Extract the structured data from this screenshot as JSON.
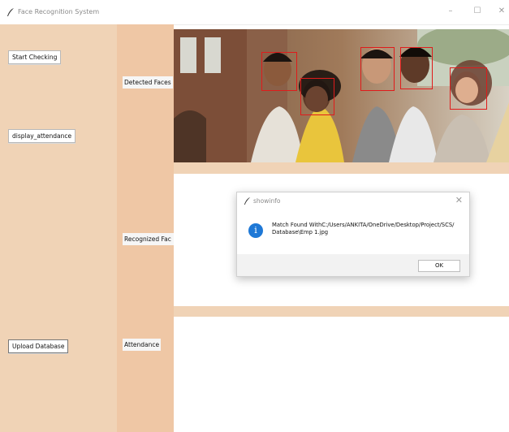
{
  "window": {
    "title": "Face Recognition System",
    "minimize": "–",
    "maximize": "☐",
    "close": "✕"
  },
  "sidebar": {
    "start_checking": "Start Checking",
    "display_attendance": "display_attendance",
    "upload_database": "Upload Database"
  },
  "labels": {
    "detected_faces": "Detected Faces",
    "recognized_faces": "Recognized Fac",
    "attendance": "Attendance"
  },
  "dialog": {
    "title": "showinfo",
    "close": "✕",
    "message": "Match Found WithC:/Users/ANKITA/OneDrive/Desktop/Project/SCS/Database\\Emp 1.jpg",
    "ok_label": "OK",
    "icon": "info-icon"
  },
  "colors": {
    "left_panel": "#f0d3b6",
    "label_column": "#efc7a5",
    "face_box": "#e01b1b",
    "info_blue": "#1e78d6"
  }
}
